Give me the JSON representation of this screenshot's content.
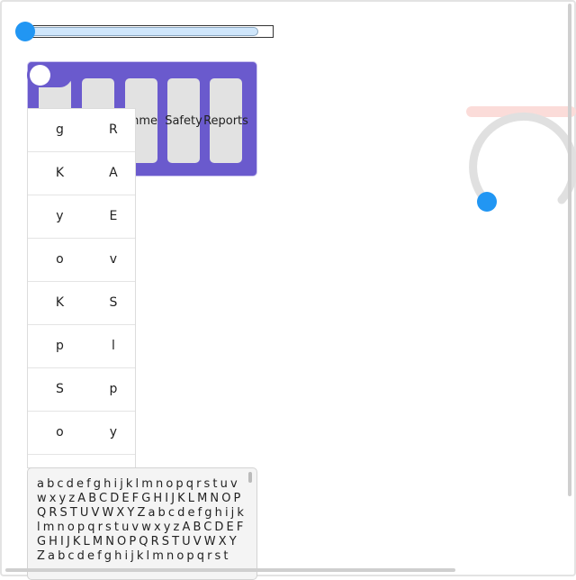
{
  "tabs": [
    "",
    "",
    "onme",
    "Safety",
    "Reports"
  ],
  "slider": {
    "value_fraction": 0.0
  },
  "toggle": {
    "on": true
  },
  "grid": [
    [
      "g",
      "R"
    ],
    [
      "K",
      "A"
    ],
    [
      "y",
      "E"
    ],
    [
      "o",
      "v"
    ],
    [
      "K",
      "S"
    ],
    [
      "p",
      "l"
    ],
    [
      "S",
      "p"
    ],
    [
      "o",
      "y"
    ]
  ],
  "text_panel": {
    "content": "abcdefghijklmnopqrstuvwxyzABCDEFGHIJKLMNOPQRSTUVWXYZabcdefghijklmnopqrstuvwxyzABCDEFGHIJKLMNOPQRSTUVWXYZabcdefghijklmnopqrst"
  },
  "dial": {
    "value_fraction": 0.0
  },
  "colors": {
    "accent": "#2196f3",
    "panel": "#6a5acd",
    "tab": "#e2e2e2"
  }
}
